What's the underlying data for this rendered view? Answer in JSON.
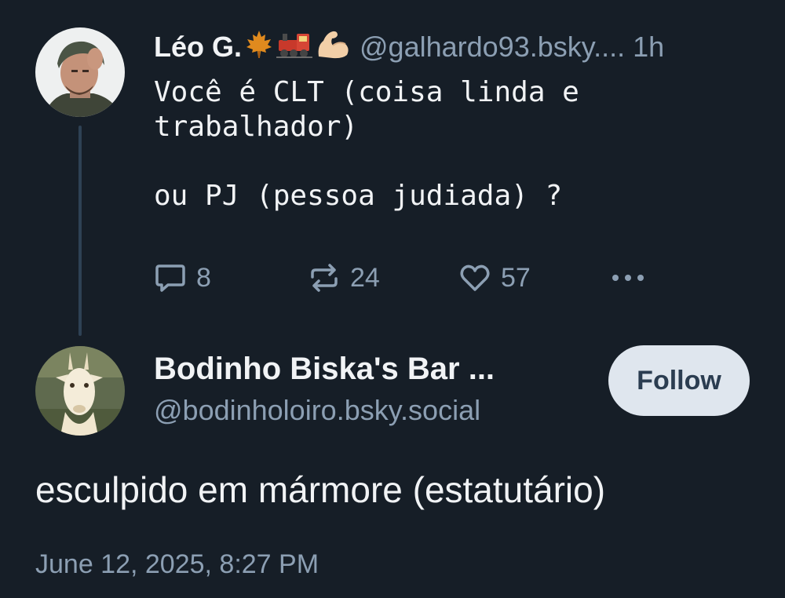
{
  "parent_post": {
    "author_name": "Léo G.",
    "author_emojis": [
      "maple-leaf",
      "locomotive",
      "flexed-biceps"
    ],
    "handle": "@galhardo93.bsky....",
    "time": "1h",
    "text": "Você é CLT (coisa linda e\ntrabalhador)\n\nou PJ (pessoa judiada) ?",
    "reply_count": "8",
    "repost_count": "24",
    "like_count": "57",
    "icons": {
      "reply": "speech-bubble-icon",
      "repost": "repost-arrows-icon",
      "like": "heart-icon",
      "more": "ellipsis-icon"
    }
  },
  "reply_post": {
    "author_name": "Bodinho Biska's Bar ...",
    "handle": "@bodinholoiro.bsky.social",
    "follow_label": "Follow",
    "text": "esculpido em mármore (estatutário)",
    "timestamp": "June 12, 2025, 8:27 PM"
  },
  "colors": {
    "background": "#161e27",
    "primary_text": "#f1f3f5",
    "secondary_text": "#8c9fb3",
    "thread_line": "#2e4154",
    "follow_bg": "#dfe6ee",
    "follow_text": "#2b3d51"
  }
}
